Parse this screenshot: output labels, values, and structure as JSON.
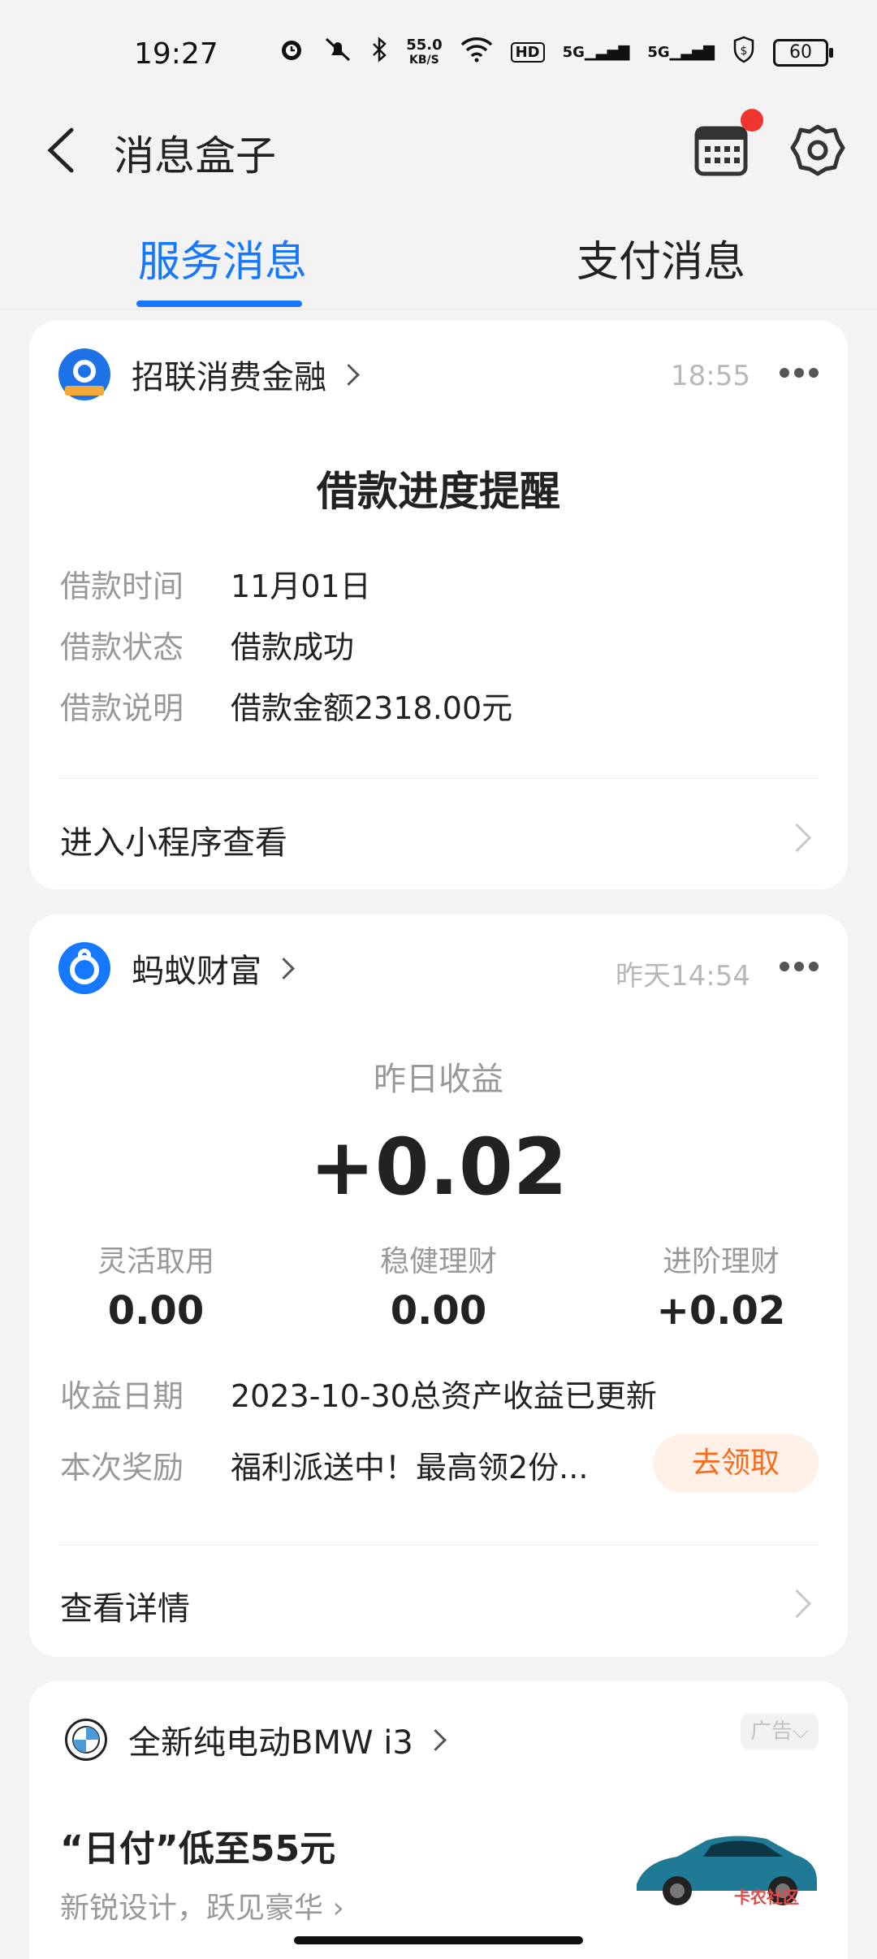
{
  "status_bar": {
    "time": "19:27",
    "net_speed_value": "55.0",
    "net_speed_unit": "KB/S",
    "hd_label": "HD",
    "signal1": "5G",
    "signal2": "5G",
    "battery": "60"
  },
  "header": {
    "title": "消息盒子"
  },
  "tabs": [
    {
      "label": "服务消息",
      "active": true
    },
    {
      "label": "支付消息",
      "active": false
    }
  ],
  "loan_card": {
    "sender": "招联消费金融",
    "time": "18:55",
    "title": "借款进度提醒",
    "rows": [
      {
        "key": "借款时间",
        "value": "11月01日"
      },
      {
        "key": "借款状态",
        "value": "借款成功"
      },
      {
        "key": "借款说明",
        "value": "借款金额2318.00元"
      }
    ],
    "link": "进入小程序查看"
  },
  "wealth_card": {
    "sender": "蚂蚁财富",
    "time": "昨天14:54",
    "earnings_label": "昨日收益",
    "earnings_value": "+0.02",
    "stats": [
      {
        "label": "灵活取用",
        "value": "0.00"
      },
      {
        "label": "稳健理财",
        "value": "0.00"
      },
      {
        "label": "进阶理财",
        "value": "+0.02"
      }
    ],
    "date_key": "收益日期",
    "date_value": "2023-10-30总资产收益已更新",
    "reward_key": "本次奖励",
    "reward_value": "福利派送中！最高领2份...",
    "claim_button": "去领取",
    "link": "查看详情"
  },
  "ad_card": {
    "sender": "全新纯电动BMW i3",
    "tag": "广告",
    "promo": "“日付”低至55元",
    "subtitle": "新锐设计，跃见豪华"
  },
  "watermark": "卡农社区",
  "colors": {
    "accent": "#1677ff",
    "orange": "#ff6a1a",
    "notification_dot": "#f0342e"
  }
}
